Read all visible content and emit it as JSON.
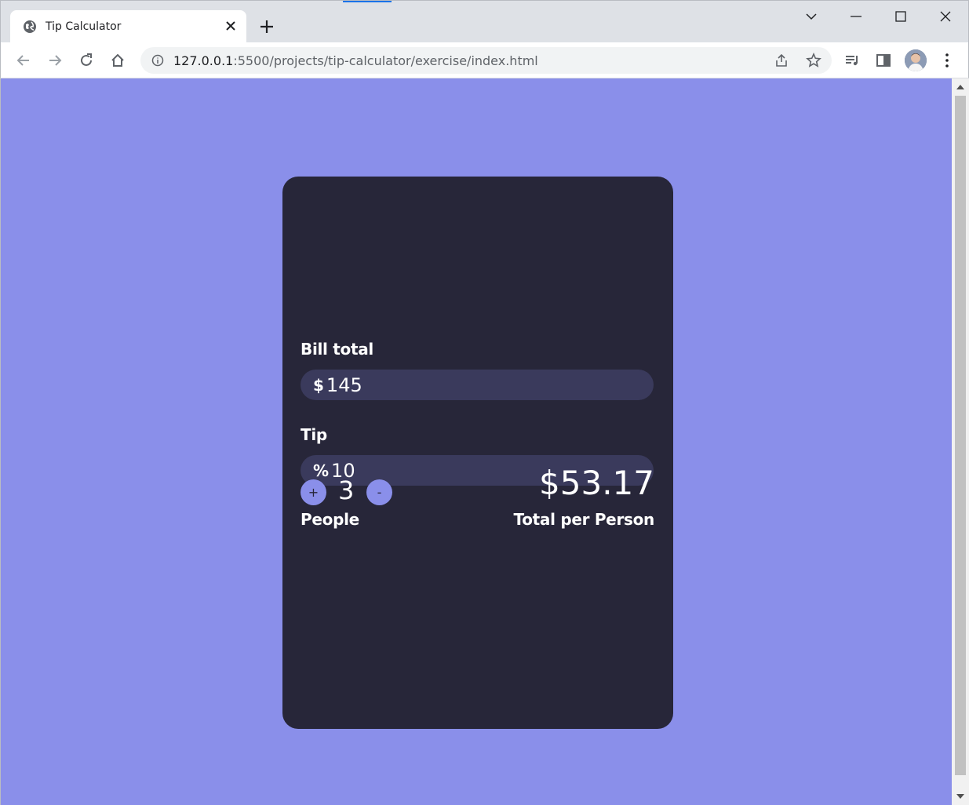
{
  "browser": {
    "tab_title": "Tip Calculator",
    "url_host": "127.0.0.1",
    "url_path": ":5500/projects/tip-calculator/exercise/index.html"
  },
  "calculator": {
    "bill_label": "Bill total",
    "bill_prefix": "$",
    "bill_value": "145",
    "tip_label": "Tip",
    "tip_prefix": "%",
    "tip_value": "10",
    "people_label": "People",
    "people_count": "3",
    "increase_label": "+",
    "decrease_label": "-",
    "total_label": "Total per Person",
    "total_value": "$53.17"
  },
  "colors": {
    "page_background": "#8a8fea",
    "card_background": "#272639",
    "input_background": "#3a3a5c",
    "button_background": "#8a8fea"
  }
}
